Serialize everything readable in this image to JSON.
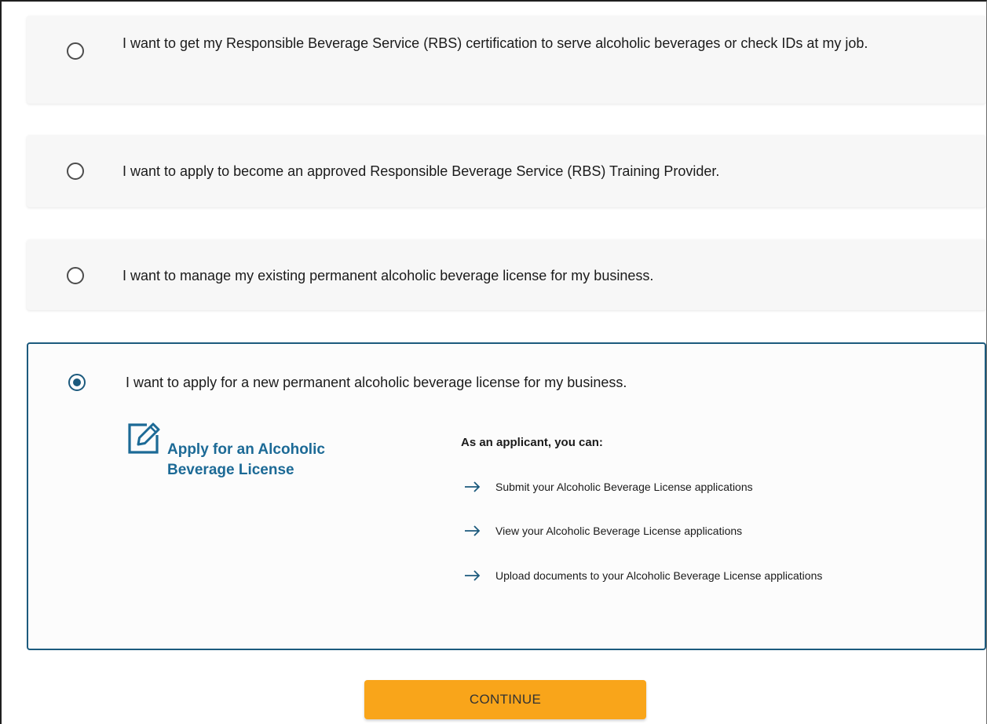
{
  "options": [
    {
      "label": "I want to get my Responsible Beverage Service (RBS) certification to serve alcoholic beverages or check IDs at my job.",
      "selected": false
    },
    {
      "label": "I want to apply to become an approved Responsible Beverage Service (RBS) Training Provider.",
      "selected": false
    },
    {
      "label": "I want to manage my existing permanent alcoholic beverage license for my business.",
      "selected": false
    },
    {
      "label": "I want to apply for a new permanent alcoholic beverage license for my business.",
      "selected": true
    }
  ],
  "selected_panel": {
    "icon": "edit-icon",
    "title": "Apply for an Alcoholic Beverage License",
    "perks_heading": "As an applicant, you can:",
    "perks": [
      "Submit your Alcoholic Beverage License applications",
      "View your Alcoholic Beverage License applications",
      "Upload documents to your Alcoholic Beverage License applications"
    ],
    "perk_icon": "arrow-right-icon"
  },
  "continue_label": "CONTINUE",
  "colors": {
    "accent": "#1c5a7d",
    "link": "#1c6a96",
    "button": "#f9a51a"
  }
}
